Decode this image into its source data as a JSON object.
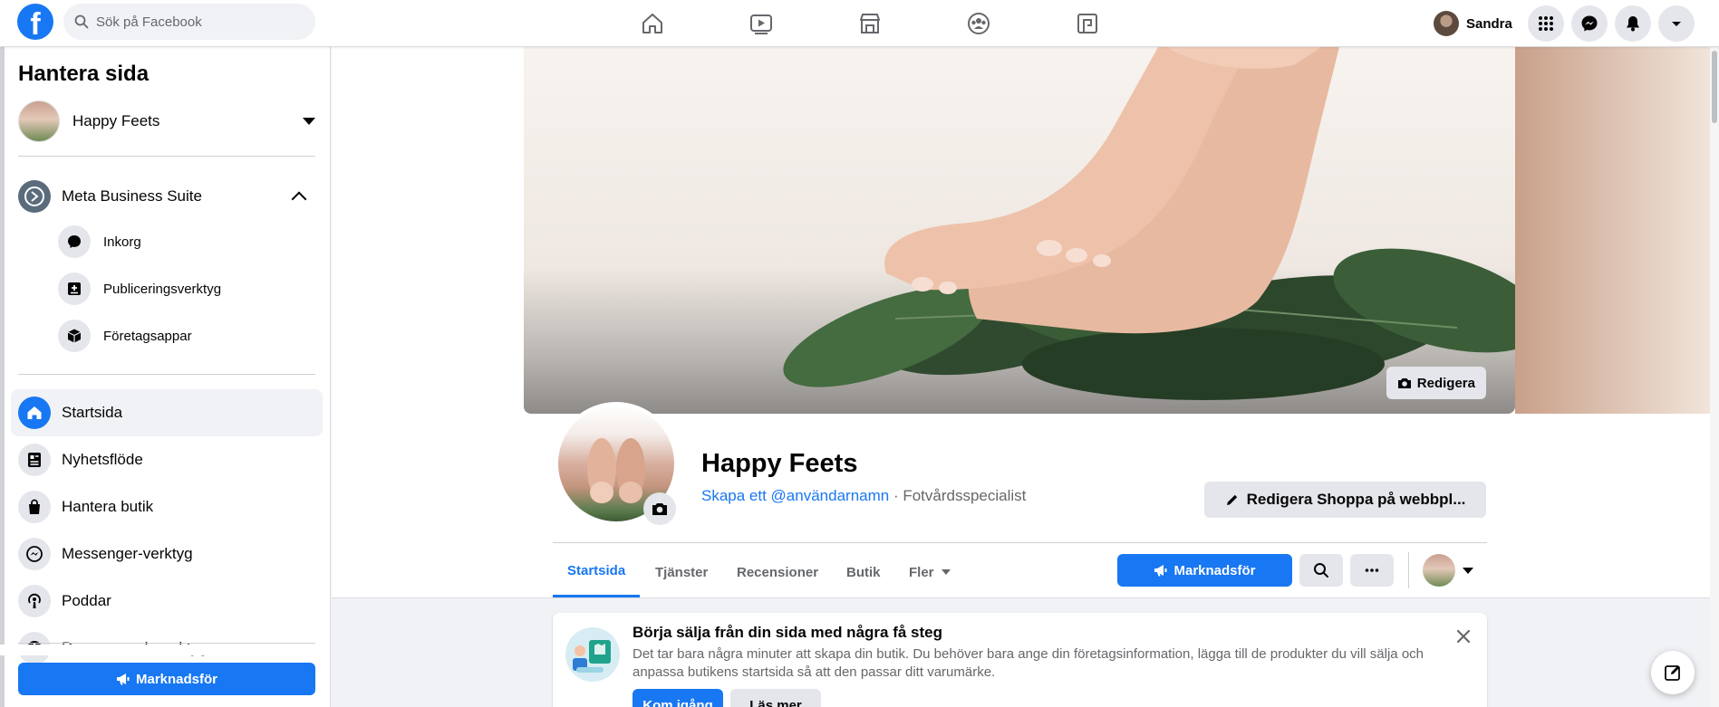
{
  "topbar": {
    "search_placeholder": "Sök på Facebook",
    "user_name": "Sandra",
    "nav_icons": [
      "home-icon",
      "watch-icon",
      "marketplace-icon",
      "groups-icon",
      "gaming-icon"
    ]
  },
  "sidebar": {
    "title": "Hantera sida",
    "page_name": "Happy Feets",
    "business_suite": "Meta Business Suite",
    "sub_items": [
      {
        "label": "Inkorg",
        "icon": "chat-bubble-icon"
      },
      {
        "label": "Publiceringsverktyg",
        "icon": "publishing-tools-icon"
      },
      {
        "label": "Företagsappar",
        "icon": "business-apps-icon"
      }
    ],
    "nav_items": [
      {
        "label": "Startsida",
        "icon": "home-icon",
        "active": true
      },
      {
        "label": "Nyhetsflöde",
        "icon": "news-feed-icon"
      },
      {
        "label": "Hantera butik",
        "icon": "shop-bag-icon"
      },
      {
        "label": "Messenger-verktyg",
        "icon": "messenger-icon"
      },
      {
        "label": "Poddar",
        "icon": "podcast-icon"
      },
      {
        "label": "Resurser och verktyg",
        "icon": "info-icon"
      }
    ],
    "promote_label": "Marknadsför"
  },
  "profile": {
    "edit_cover_label": "Redigera",
    "page_name": "Happy Feets",
    "username_link": "Skapa ett @användarnamn",
    "category": " · Fotvårdsspecialist",
    "edit_shop_label": "Redigera Shoppa på webbpl..."
  },
  "tabs": [
    {
      "label": "Startsida",
      "active": true
    },
    {
      "label": "Tjänster"
    },
    {
      "label": "Recensioner"
    },
    {
      "label": "Butik"
    },
    {
      "label": "Fler"
    }
  ],
  "actions": {
    "promote_label": "Marknadsför"
  },
  "card": {
    "title": "Börja sälja från din sida med några få steg",
    "text": "Det tar bara några minuter att skapa din butik. Du behöver bara ange din företagsinformation, lägga till de produkter du vill sälja och anpassa butikens startsida så att den passar ditt varumärke.",
    "primary_label": "Kom igång",
    "secondary_label": "Läs mer"
  },
  "colors": {
    "accent": "#1877f2",
    "background": "#f0f2f5",
    "secondary_text": "#65676b"
  }
}
